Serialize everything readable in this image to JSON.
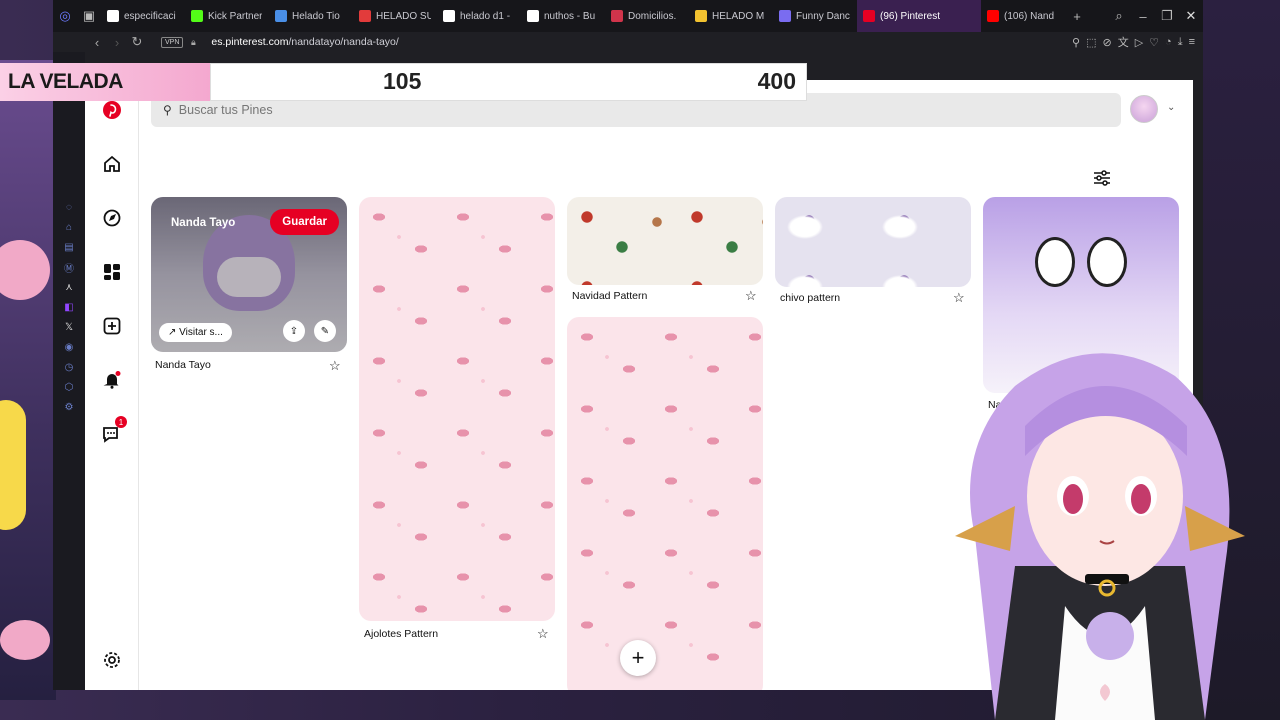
{
  "browser": {
    "tabs": [
      {
        "label": "especificaci",
        "fav_color": "#ffffff"
      },
      {
        "label": "Kick Partner",
        "fav_color": "#53fc18"
      },
      {
        "label": "Helado Tio",
        "fav_color": "#4a8fe7"
      },
      {
        "label": "HELADO SU",
        "fav_color": "#e23b3b"
      },
      {
        "label": "helado d1 -",
        "fav_color": "#ffffff"
      },
      {
        "label": "nuthos - Bu",
        "fav_color": "#ffffff"
      },
      {
        "label": "Domicilios.",
        "fav_color": "#d0344b"
      },
      {
        "label": "HELADO M",
        "fav_color": "#f2c230"
      },
      {
        "label": "Funny Danc",
        "fav_color": "#7a6cf0"
      },
      {
        "label": "(96) Pinterest",
        "fav_color": "#e60023",
        "active": true
      },
      {
        "label": "(106) Nand",
        "fav_color": "#ff0000"
      }
    ],
    "vpn_label": "VPN",
    "url_host": "es.pinterest.com",
    "url_path": "/nandatayo/nanda-tayo/"
  },
  "score": {
    "name": "LA VELADA",
    "left_value": "105",
    "right_value": "400"
  },
  "pinterest": {
    "search_placeholder": "Buscar tus Pines",
    "notification_badge": "1",
    "pins": [
      {
        "title": "Nanda Tayo",
        "board_label": "Nanda Tayo",
        "save_label": "Guardar",
        "visit_label": "Visitar s..."
      },
      {
        "title": "Ajolotes Pattern"
      },
      {
        "title": "Navidad Pattern"
      },
      {
        "title": "chivo pattern"
      },
      {
        "title": "Nanda V"
      }
    ]
  },
  "colors": {
    "brand": "#e60023",
    "accent": "#3a2050"
  }
}
